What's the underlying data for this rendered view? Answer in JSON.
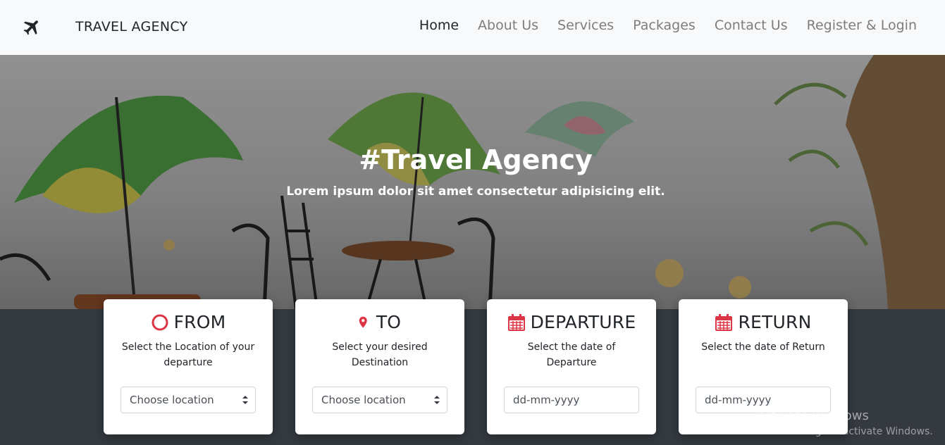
{
  "navbar": {
    "brand": "TRAVEL AGENCY",
    "links": [
      "Home",
      "About Us",
      "Services",
      "Packages",
      "Contact Us",
      "Register & Login"
    ]
  },
  "hero": {
    "title": "#Travel Agency",
    "subtitle": "Lorem ipsum dolor sit amet consectetur adipisicing elit."
  },
  "cards": [
    {
      "title": "FROM",
      "icon": "circle-icon",
      "description": "Select the Location of your departure",
      "field_value": "Choose location"
    },
    {
      "title": "TO",
      "icon": "map-pin-icon",
      "description": "Select your desired Destination",
      "field_value": "Choose location"
    },
    {
      "title": "DEPARTURE",
      "icon": "calendar-icon",
      "description": "Select the date of Departure",
      "field_value": "dd-mm-yyyy"
    },
    {
      "title": "RETURN",
      "icon": "calendar-icon",
      "description": "Select the date of Return",
      "field_value": "dd-mm-yyyy"
    }
  ],
  "watermark": {
    "line1": "Activate Windows",
    "line2": "Go to Settings to activate Windows."
  },
  "colors": {
    "accent": "#dc3545",
    "navbar_bg": "#f8f9fa",
    "footer_bg": "#343a40"
  }
}
